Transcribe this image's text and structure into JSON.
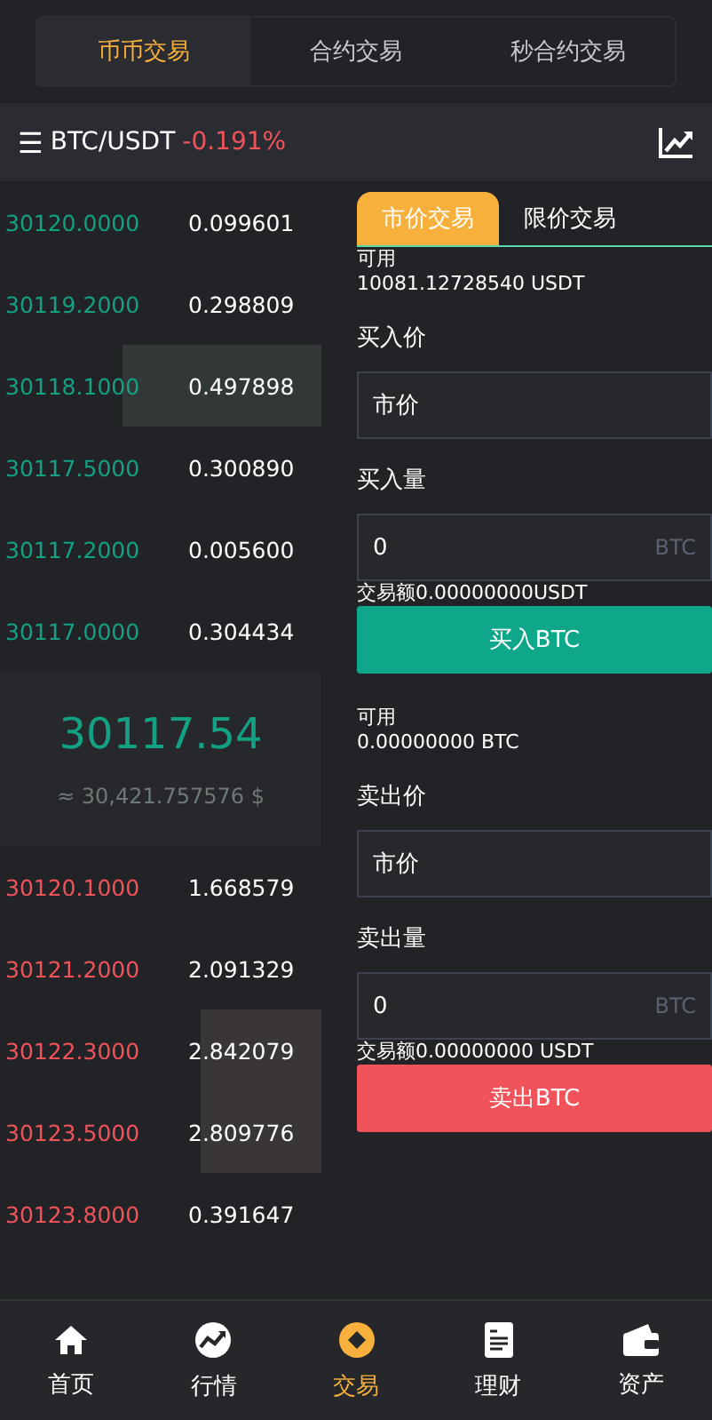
{
  "mode_tabs": [
    {
      "label": "币币交易",
      "selected": true
    },
    {
      "label": "合约交易",
      "selected": false
    },
    {
      "label": "秒合约交易",
      "selected": false
    }
  ],
  "header": {
    "menu_icon": "☰",
    "pair": "BTC/USDT",
    "change": "-0.191%"
  },
  "bids": [
    {
      "price": "30120.0000",
      "amount": "0.099601",
      "highlighted": false
    },
    {
      "price": "30119.2000",
      "amount": "0.298809",
      "highlighted": false
    },
    {
      "price": "30118.1000",
      "amount": "0.497898",
      "highlighted": true
    },
    {
      "price": "30117.5000",
      "amount": "0.300890",
      "highlighted": false
    },
    {
      "price": "30117.2000",
      "amount": "0.005600",
      "highlighted": false
    },
    {
      "price": "30117.0000",
      "amount": "0.304434",
      "highlighted": false
    }
  ],
  "last_price": "30117.54",
  "last_price_usd": "≈ 30,421.757576 $",
  "asks": [
    {
      "price": "30120.1000",
      "amount": "1.668579",
      "highlighted": false
    },
    {
      "price": "30121.2000",
      "amount": "2.091329",
      "highlighted": false
    },
    {
      "price": "30122.3000",
      "amount": "2.842079",
      "highlighted": true
    },
    {
      "price": "30123.5000",
      "amount": "2.809776",
      "highlighted": true
    },
    {
      "price": "30123.8000",
      "amount": "0.391647",
      "highlighted": false
    }
  ],
  "order_tabs": [
    {
      "label": "市价交易",
      "selected": true
    },
    {
      "label": "限价交易",
      "selected": false
    }
  ],
  "buy": {
    "available_label": "可用",
    "available": "10081.12728540  USDT",
    "price_label": "买入价",
    "price_value": "市价",
    "amount_label": "买入量",
    "amount_value": "0",
    "amount_unit": "BTC",
    "total": "交易额0.00000000USDT",
    "button": "买入BTC"
  },
  "sell": {
    "available_label": "可用",
    "available": "0.00000000  BTC",
    "price_label": "卖出价",
    "price_value": "市价",
    "amount_label": "卖出量",
    "amount_value": "0",
    "amount_unit": "BTC",
    "total": "交易额0.00000000 USDT",
    "button": "卖出BTC"
  },
  "nav": [
    {
      "label": "首页",
      "kind": "home",
      "selected": false
    },
    {
      "label": "行情",
      "kind": "market",
      "selected": false
    },
    {
      "label": "交易",
      "kind": "trade",
      "selected": true
    },
    {
      "label": "理财",
      "kind": "finance",
      "selected": false
    },
    {
      "label": "资产",
      "kind": "assets",
      "selected": false
    }
  ]
}
